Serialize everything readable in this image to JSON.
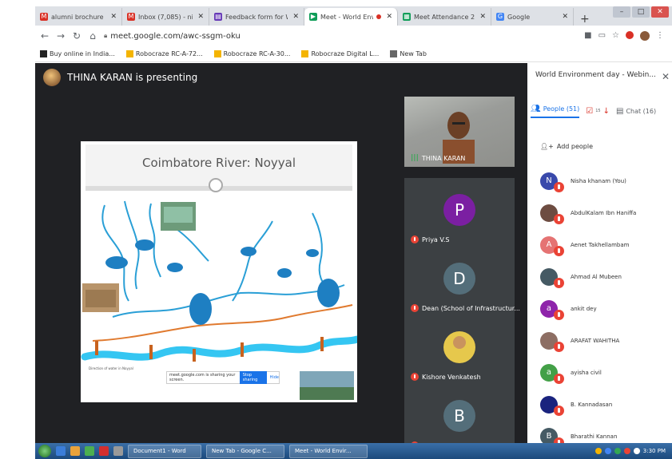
{
  "browser": {
    "tabs": [
      {
        "label": "alumni brochure - nisha",
        "favicon": "gmail-icon",
        "color": "#d93025",
        "glyph": "M"
      },
      {
        "label": "Inbox (7,085) - nishakh",
        "favicon": "gmail-icon",
        "color": "#d93025",
        "glyph": "M"
      },
      {
        "label": "Feedback form for Worl",
        "favicon": "forms-icon",
        "color": "#673ab7",
        "glyph": "▤"
      },
      {
        "label": "Meet - World Envi",
        "favicon": "meet-icon",
        "color": "#0f9d58",
        "glyph": "▶",
        "active": true
      },
      {
        "label": "Meet Attendance 2020",
        "favicon": "sheets-icon",
        "color": "#0f9d58",
        "glyph": "▦"
      },
      {
        "label": "Google",
        "favicon": "google-icon",
        "color": "#4285f4",
        "glyph": "G"
      }
    ],
    "url": "meet.google.com/awc-ssgm-oku",
    "bookmarks": [
      {
        "label": "Buy online in India...",
        "color": "#222"
      },
      {
        "label": "Robocraze RC-A-72...",
        "color": "#f4b400"
      },
      {
        "label": "Robocraze RC-A-30...",
        "color": "#f4b400"
      },
      {
        "label": "Robocraze Digital L...",
        "color": "#f4b400"
      },
      {
        "label": "New Tab",
        "color": "#666"
      }
    ]
  },
  "meet": {
    "presenting_label": "THINA KARAN is presenting",
    "slide": {
      "title": "Coimbatore River: Noyyal",
      "share_notice": "meet.google.com is sharing your screen.",
      "stop_label": "Stop sharing",
      "hide_label": "Hide"
    },
    "tiles": [
      {
        "name": "THINA KARAN",
        "initial": "",
        "color": "",
        "video": true
      },
      {
        "name": "Priya V.S",
        "initial": "P",
        "color": "#7b1fa2"
      },
      {
        "name": "Dean (School of Infrastructur...",
        "initial": "D",
        "color": "#546e7a"
      },
      {
        "name": "Kishore Venkatesh",
        "initial": "",
        "color": "#e6c84c",
        "photo": true
      },
      {
        "name": "Bharathi Kannan",
        "initial": "B",
        "color": "#546e7a"
      }
    ]
  },
  "panel": {
    "title": "World Environment day - Webin...",
    "tabs": {
      "people": "People (51)",
      "badge": "15",
      "chat": "Chat (16)"
    },
    "add_people": "Add people",
    "participants": [
      {
        "name": "Nisha khanam (You)",
        "initial": "N",
        "color": "#3949ab"
      },
      {
        "name": "AbdulKalam Ibn Haniffa",
        "initial": "",
        "color": "#6d4c41"
      },
      {
        "name": "Aenet Takhellambam",
        "initial": "A",
        "color": "#e57373"
      },
      {
        "name": "Ahmad Al Mubeen",
        "initial": "",
        "color": "#455a64"
      },
      {
        "name": "ankit dey",
        "initial": "a",
        "color": "#8e24aa"
      },
      {
        "name": "ARAFAT WAHITHA",
        "initial": "",
        "color": "#8d6e63"
      },
      {
        "name": "ayisha civil",
        "initial": "a",
        "color": "#43a047"
      },
      {
        "name": "B. Kannadasan",
        "initial": "",
        "color": "#1a237e"
      },
      {
        "name": "Bharathi Kannan",
        "initial": "B",
        "color": "#455a64"
      }
    ]
  },
  "taskbar": {
    "buttons": [
      "Document1 - Word",
      "New Tab - Google C...",
      "Meet - World Envir..."
    ],
    "time": "3:30 PM"
  }
}
